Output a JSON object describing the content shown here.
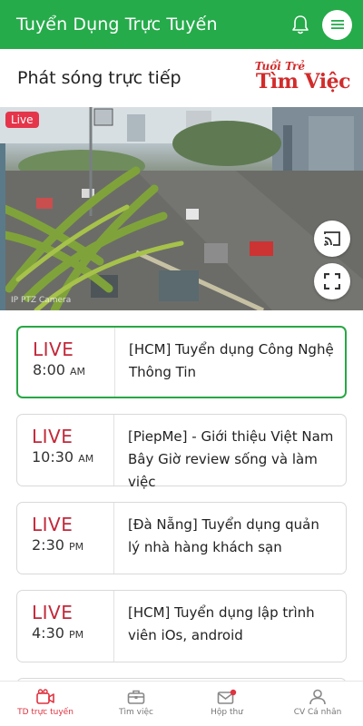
{
  "appbar": {
    "title": "Tuyển Dụng Trực Tuyến"
  },
  "section": {
    "title": "Phát sóng trực tiếp",
    "logo_top": "Tuổi Trẻ",
    "logo_main": "Tìm Việc"
  },
  "video": {
    "live_badge": "Live",
    "camera_label": "IP PTZ Camera"
  },
  "streams": [
    {
      "live": "LIVE",
      "time": "8:00",
      "period": "AM",
      "title": "[HCM] Tuyển dụng Công Nghệ Thông Tin",
      "active": true
    },
    {
      "live": "LIVE",
      "time": "10:30",
      "period": "AM",
      "title": "[PiepMe] - Giới thiệu Việt Nam Bây Giờ review sống và làm việc",
      "active": false
    },
    {
      "live": "LIVE",
      "time": "2:30",
      "period": "PM",
      "title": "[Đà Nẵng] Tuyển dụng quản lý nhà hàng khách sạn",
      "active": false
    },
    {
      "live": "LIVE",
      "time": "4:30",
      "period": "PM",
      "title": "[HCM] Tuyển dụng lập trình viên iOs, android",
      "active": false
    }
  ],
  "tabs": [
    {
      "label": "TD trực tuyến",
      "icon": "live-camera-icon",
      "active": true
    },
    {
      "label": "Tìm việc",
      "icon": "briefcase-icon",
      "active": false
    },
    {
      "label": "Hộp thư",
      "icon": "mail-icon",
      "active": false
    },
    {
      "label": "CV Cá nhân",
      "icon": "user-icon",
      "active": false
    }
  ],
  "colors": {
    "brand_green": "#25ab4a",
    "live_red": "#c2283a",
    "active_tab_red": "#e0323f",
    "active_border": "#28a745"
  }
}
